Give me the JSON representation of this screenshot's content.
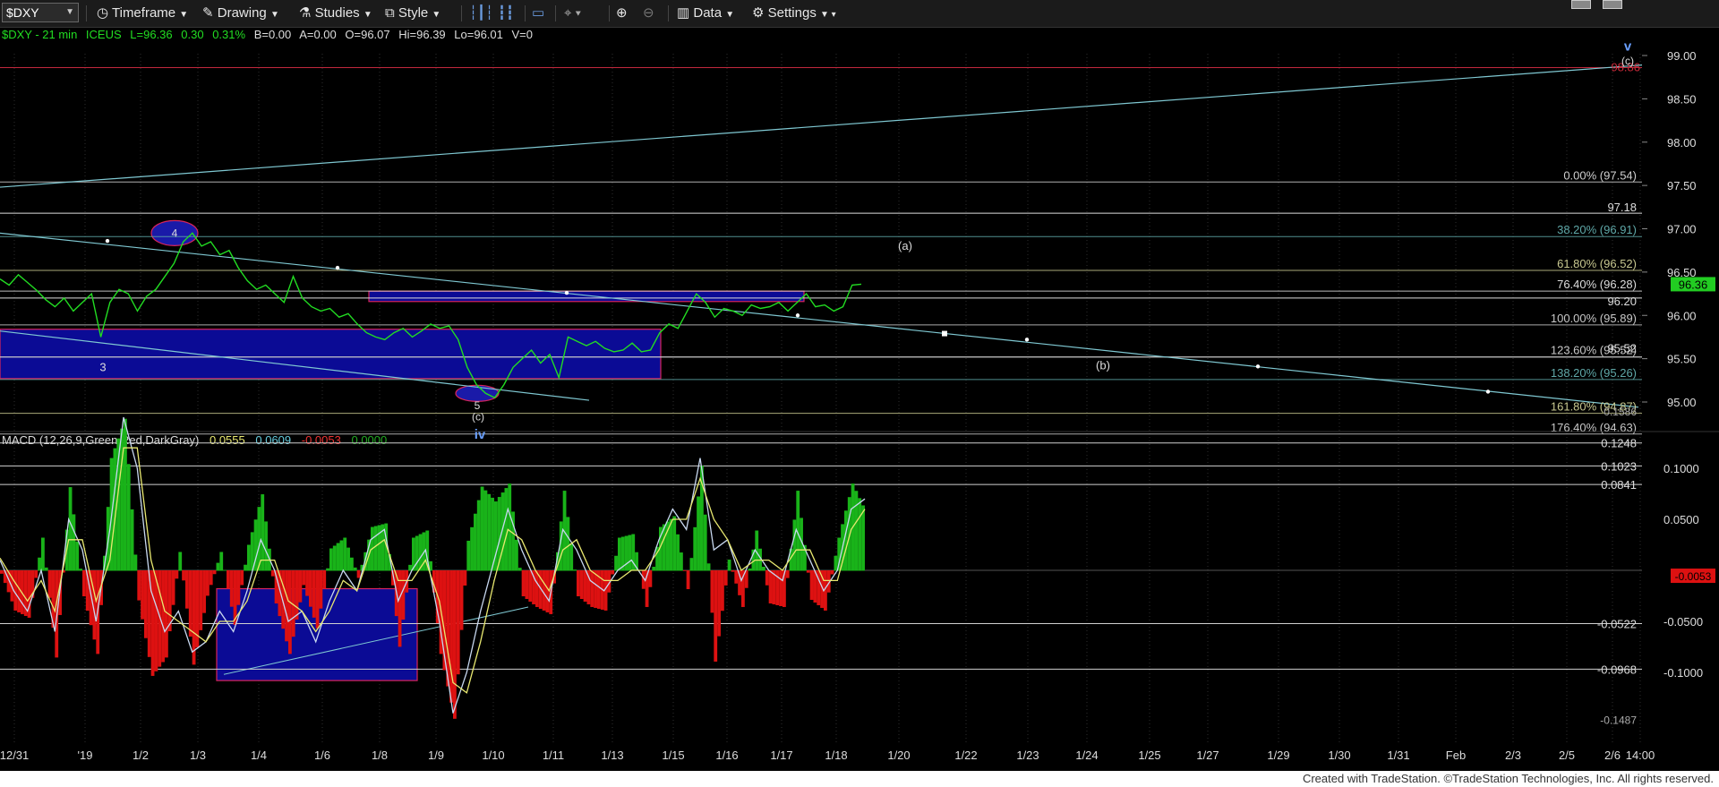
{
  "toolbar": {
    "symbol": "$DXY",
    "items": [
      {
        "name": "timeframe",
        "label": "Timeframe"
      },
      {
        "name": "drawing",
        "label": "Drawing"
      },
      {
        "name": "studies",
        "label": "Studies"
      },
      {
        "name": "style",
        "label": "Style"
      },
      {
        "name": "data",
        "label": "Data"
      },
      {
        "name": "settings",
        "label": "Settings"
      }
    ]
  },
  "header": {
    "symbol": "$DXY - 21 min",
    "exchange": "ICEUS",
    "last": "L=96.36",
    "chg": "0.30",
    "pct": "0.31%",
    "bid": "B=0.00",
    "ask": "A=0.00",
    "open": "O=96.07",
    "high": "Hi=96.39",
    "low": "Lo=96.01",
    "vol": "V=0"
  },
  "macd_header": {
    "label": "MACD (12,26,9,Green,Red,DarkGray)",
    "v1": "0.0555",
    "v2": "0.0609",
    "v3": "-0.0053",
    "v4": "0.0000"
  },
  "footer": "Created with TradeStation. ©TradeStation Technologies, Inc. All rights reserved.",
  "colors": {
    "price": "#22dd22",
    "trendline": "#7fc8d2",
    "box_fill": "#0b0b95",
    "box_border": "#d8245a",
    "red_line": "#c0283c",
    "fib_yellow": "#c8c890",
    "fib_teal": "#5fa8a8",
    "macd_pos": "#19b319",
    "macd_neg": "#dd1111",
    "macd_line": "#c8d8f0",
    "signal_line": "#e8e870"
  },
  "chart_data": {
    "type": "line",
    "title": "$DXY - 21 min",
    "price_axis": {
      "ylim": [
        94.4,
        99.4
      ],
      "ticks": [
        "99.00",
        "98.50",
        "98.00",
        "97.50",
        "97.00",
        "96.50",
        "96.00",
        "95.50",
        "95.00"
      ]
    },
    "x_tick_labels": [
      "12/31",
      "'19",
      "1/2",
      "1/3",
      "1/4",
      "1/6",
      "1/8",
      "1/9",
      "1/10",
      "1/11",
      "1/13",
      "1/15",
      "1/16",
      "1/17",
      "1/18",
      "1/20",
      "1/22",
      "1/23",
      "1/24",
      "1/25",
      "1/27",
      "1/29",
      "1/30",
      "1/31",
      "Feb",
      "2/3",
      "2/5",
      "2/6",
      "14:00"
    ],
    "series": [
      {
        "values": [
          96.42,
          96.35,
          96.47,
          96.38,
          96.29,
          96.18,
          96.1,
          96.2,
          96.05,
          96.15,
          96.25,
          95.75,
          96.15,
          96.3,
          96.25,
          96.05,
          96.22,
          96.3,
          96.45,
          96.6,
          96.85,
          96.95,
          96.8,
          96.85,
          96.7,
          96.75,
          96.55,
          96.4,
          96.3,
          96.35,
          96.25,
          96.15,
          96.45,
          96.2,
          96.1,
          96.05,
          96.08,
          95.98,
          96.02,
          95.9,
          95.8,
          95.75,
          95.72,
          95.8,
          95.85,
          95.75,
          95.82,
          95.9,
          95.85,
          95.88,
          95.72,
          95.4,
          95.2,
          95.1,
          95.05,
          95.2,
          95.4,
          95.5,
          95.6,
          95.45,
          95.55,
          95.28,
          95.75,
          95.7,
          95.65,
          95.7,
          95.62,
          95.58,
          95.6,
          95.68,
          95.58,
          95.6,
          95.8,
          95.9,
          95.85,
          96.05,
          96.25,
          96.15,
          95.98,
          96.08,
          96.05,
          96.0,
          96.12,
          96.08,
          96.1,
          96.15,
          96.05,
          96.15,
          96.25,
          96.1,
          96.12,
          96.05,
          96.1,
          96.35,
          96.36
        ]
      }
    ],
    "fib_levels": [
      {
        "label": "0.00% (97.54)",
        "value": 97.54
      },
      {
        "label": "38.20% (96.91)",
        "value": 96.91
      },
      {
        "label": "61.80% (96.52)",
        "value": 96.52
      },
      {
        "label": "76.40% (96.28)",
        "value": 96.28
      },
      {
        "label": "100.00% (95.89)",
        "value": 95.89
      },
      {
        "label": "123.60% (95.52)",
        "value": 95.52
      },
      {
        "label": "138.20% (95.26)",
        "value": 95.26
      },
      {
        "label": "161.80% (94.87)",
        "value": 94.87
      },
      {
        "label": "176.40% (94.63)",
        "value": 94.63
      }
    ],
    "price_labels": [
      {
        "label": "97.18",
        "value": 97.18
      },
      {
        "label": "96.20",
        "value": 96.2
      },
      {
        "label": "95.52",
        "value": 95.52
      },
      {
        "label": "98.86",
        "value": 98.86
      },
      {
        "label": "96.36",
        "value": 96.36
      }
    ],
    "wave_labels": [
      {
        "label": "3"
      },
      {
        "label": "4"
      },
      {
        "label": "5"
      },
      {
        "label": "(c)"
      },
      {
        "label": "iv"
      },
      {
        "label": "(a)"
      },
      {
        "label": "(b)"
      },
      {
        "label": "(c)"
      },
      {
        "label": "v"
      }
    ],
    "macd_axis": {
      "ylim": [
        -0.1487,
        0.1586
      ],
      "ticks": [
        "0.1000",
        "0.0500",
        "-0.0500",
        "-0.1000"
      ],
      "top_label": "0.1586",
      "bottom_label": "-0.1487"
    },
    "macd_levels": [
      {
        "label": "0.1248",
        "value": 0.1248
      },
      {
        "label": "0.1023",
        "value": 0.1023
      },
      {
        "label": "0.0841",
        "value": 0.0841
      },
      {
        "label": "-0.0522",
        "value": -0.0522
      },
      {
        "label": "-0.0968",
        "value": -0.0968
      }
    ],
    "macd_current": "-0.0053",
    "macd_series": [
      {
        "name": "MACD",
        "values": [
          0.01,
          -0.02,
          -0.04,
          0.0,
          -0.06,
          0.05,
          0.02,
          -0.05,
          0.04,
          0.15,
          0.1,
          -0.02,
          -0.06,
          -0.04,
          -0.08,
          -0.07,
          -0.04,
          -0.06,
          -0.02,
          0.03,
          0.0,
          -0.05,
          -0.04,
          -0.07,
          -0.03,
          0.0,
          -0.02,
          0.03,
          0.04,
          -0.03,
          0.0,
          0.02,
          -0.05,
          -0.14,
          -0.1,
          -0.04,
          0.01,
          0.06,
          0.02,
          -0.01,
          -0.03,
          0.04,
          0.02,
          -0.01,
          -0.02,
          0.0,
          0.01,
          -0.01,
          0.03,
          0.06,
          0.04,
          0.11,
          0.02,
          0.03,
          -0.01,
          0.02,
          0.0,
          -0.01,
          0.04,
          0.01,
          -0.02,
          0.0,
          0.06,
          0.07
        ]
      },
      {
        "name": "Signal",
        "values": [
          0.012,
          -0.01,
          -0.03,
          -0.01,
          -0.04,
          0.03,
          0.03,
          -0.03,
          0.01,
          0.12,
          0.12,
          0.01,
          -0.04,
          -0.05,
          -0.06,
          -0.07,
          -0.05,
          -0.05,
          -0.03,
          0.01,
          0.01,
          -0.03,
          -0.04,
          -0.06,
          -0.04,
          -0.01,
          -0.02,
          0.02,
          0.03,
          -0.01,
          -0.01,
          0.01,
          -0.03,
          -0.11,
          -0.12,
          -0.07,
          -0.01,
          0.04,
          0.03,
          0.0,
          -0.02,
          0.02,
          0.03,
          0.0,
          -0.01,
          -0.01,
          0.0,
          0.0,
          0.02,
          0.05,
          0.05,
          0.09,
          0.05,
          0.03,
          0.0,
          0.01,
          0.01,
          0.0,
          0.02,
          0.02,
          -0.01,
          -0.01,
          0.04,
          0.06
        ]
      }
    ]
  }
}
